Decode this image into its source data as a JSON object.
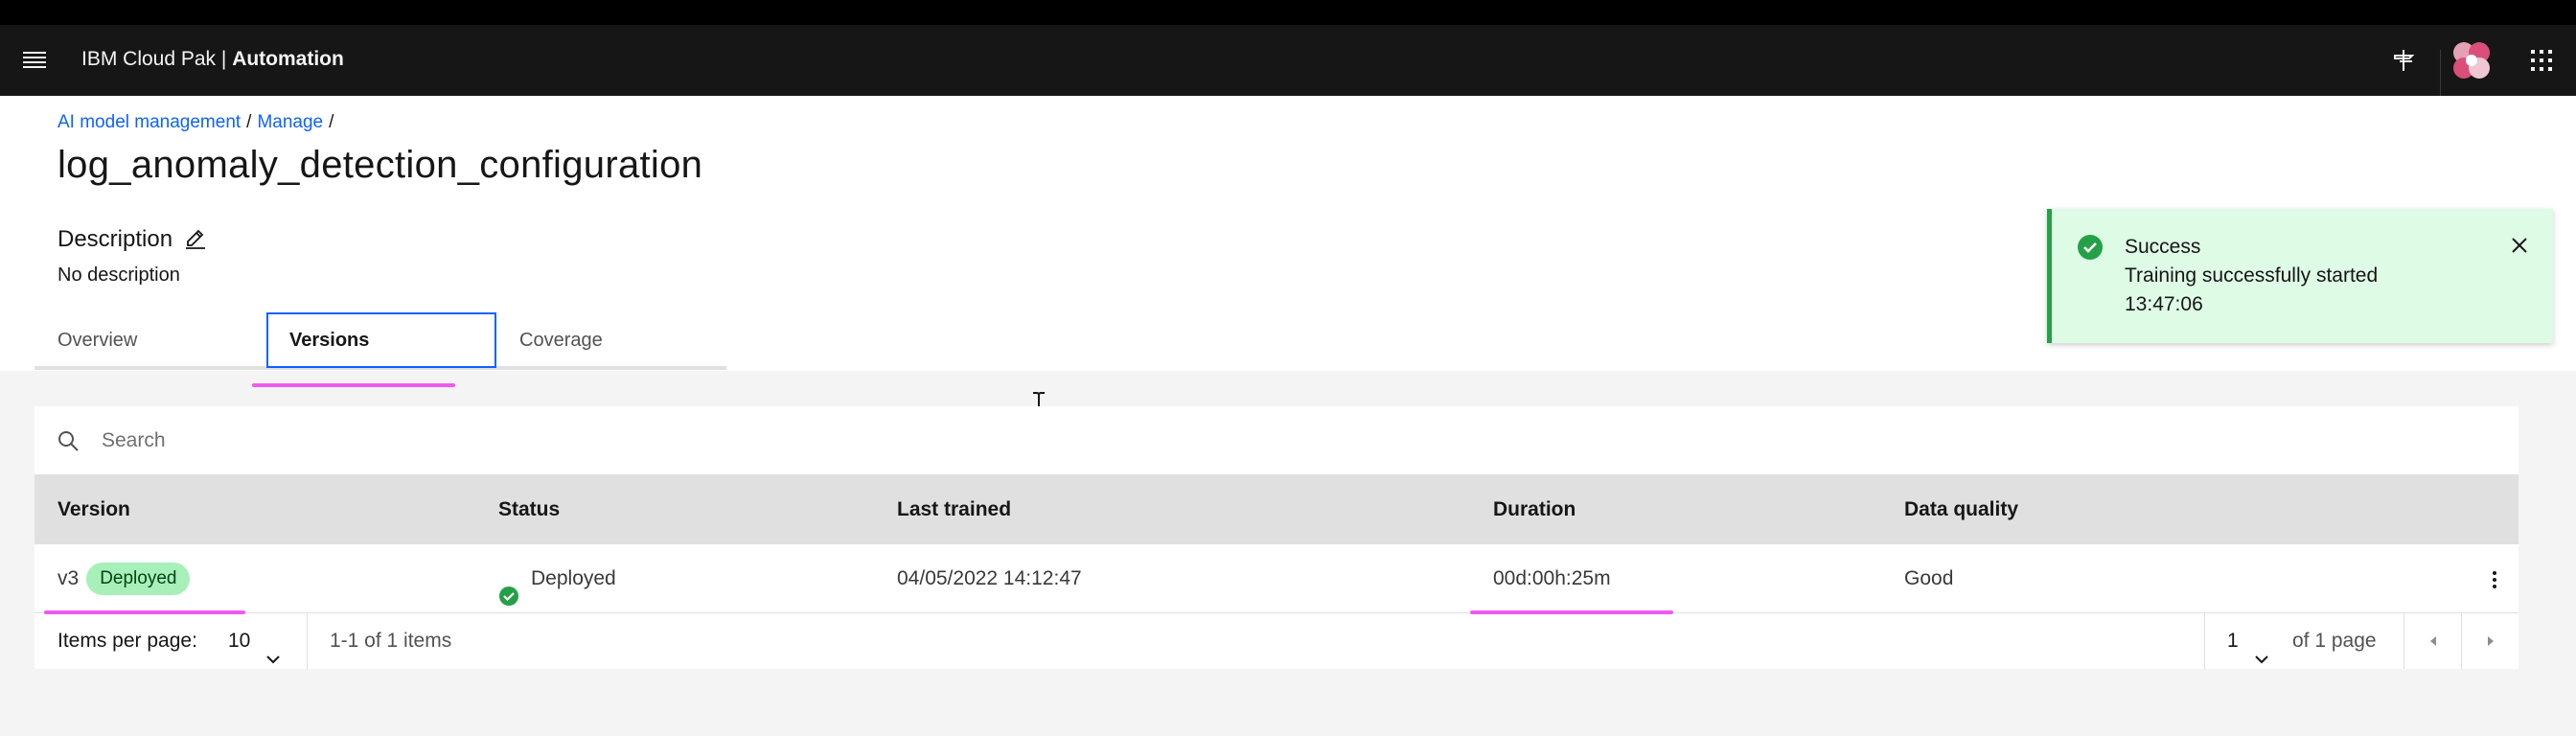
{
  "header": {
    "brand_prefix": "IBM Cloud Pak | ",
    "brand_suffix": "Automation",
    "icons": [
      "menu-icon",
      "pin-icon",
      "avatar",
      "app-switcher-icon"
    ]
  },
  "breadcrumb": {
    "items": [
      "AI model management",
      "Manage"
    ],
    "separator": "/"
  },
  "page": {
    "title": "log_anomaly_detection_configuration",
    "description_label": "Description",
    "description_value": "No description"
  },
  "tabs": [
    {
      "label": "Overview",
      "selected": false
    },
    {
      "label": "Versions",
      "selected": true
    },
    {
      "label": "Coverage",
      "selected": false
    }
  ],
  "toast": {
    "title": "Success",
    "subtitle": "Training successfully started",
    "time": "13:47:06",
    "kind": "success"
  },
  "search": {
    "placeholder": "Search",
    "value": ""
  },
  "table": {
    "headers": [
      "Version",
      "Status",
      "Last trained",
      "Duration",
      "Data quality"
    ],
    "rows": [
      {
        "version": "v3",
        "version_tag": "Deployed",
        "status": "Deployed",
        "last_trained": "04/05/2022 14:12:47",
        "duration": "00d:00h:25m",
        "data_quality": "Good"
      }
    ]
  },
  "pagination": {
    "items_per_page_label": "Items per page:",
    "items_per_page_value": "10",
    "range_text": "1-1 of 1 items",
    "page_value": "1",
    "page_total_text": "of 1 page"
  },
  "colors": {
    "header_bg": "#161616",
    "link": "#0f62fe",
    "success": "#24a148",
    "toast_bg": "#defbe6",
    "tag_bg": "#a7f0ba",
    "highlight_marks": "#ee5bf0"
  }
}
